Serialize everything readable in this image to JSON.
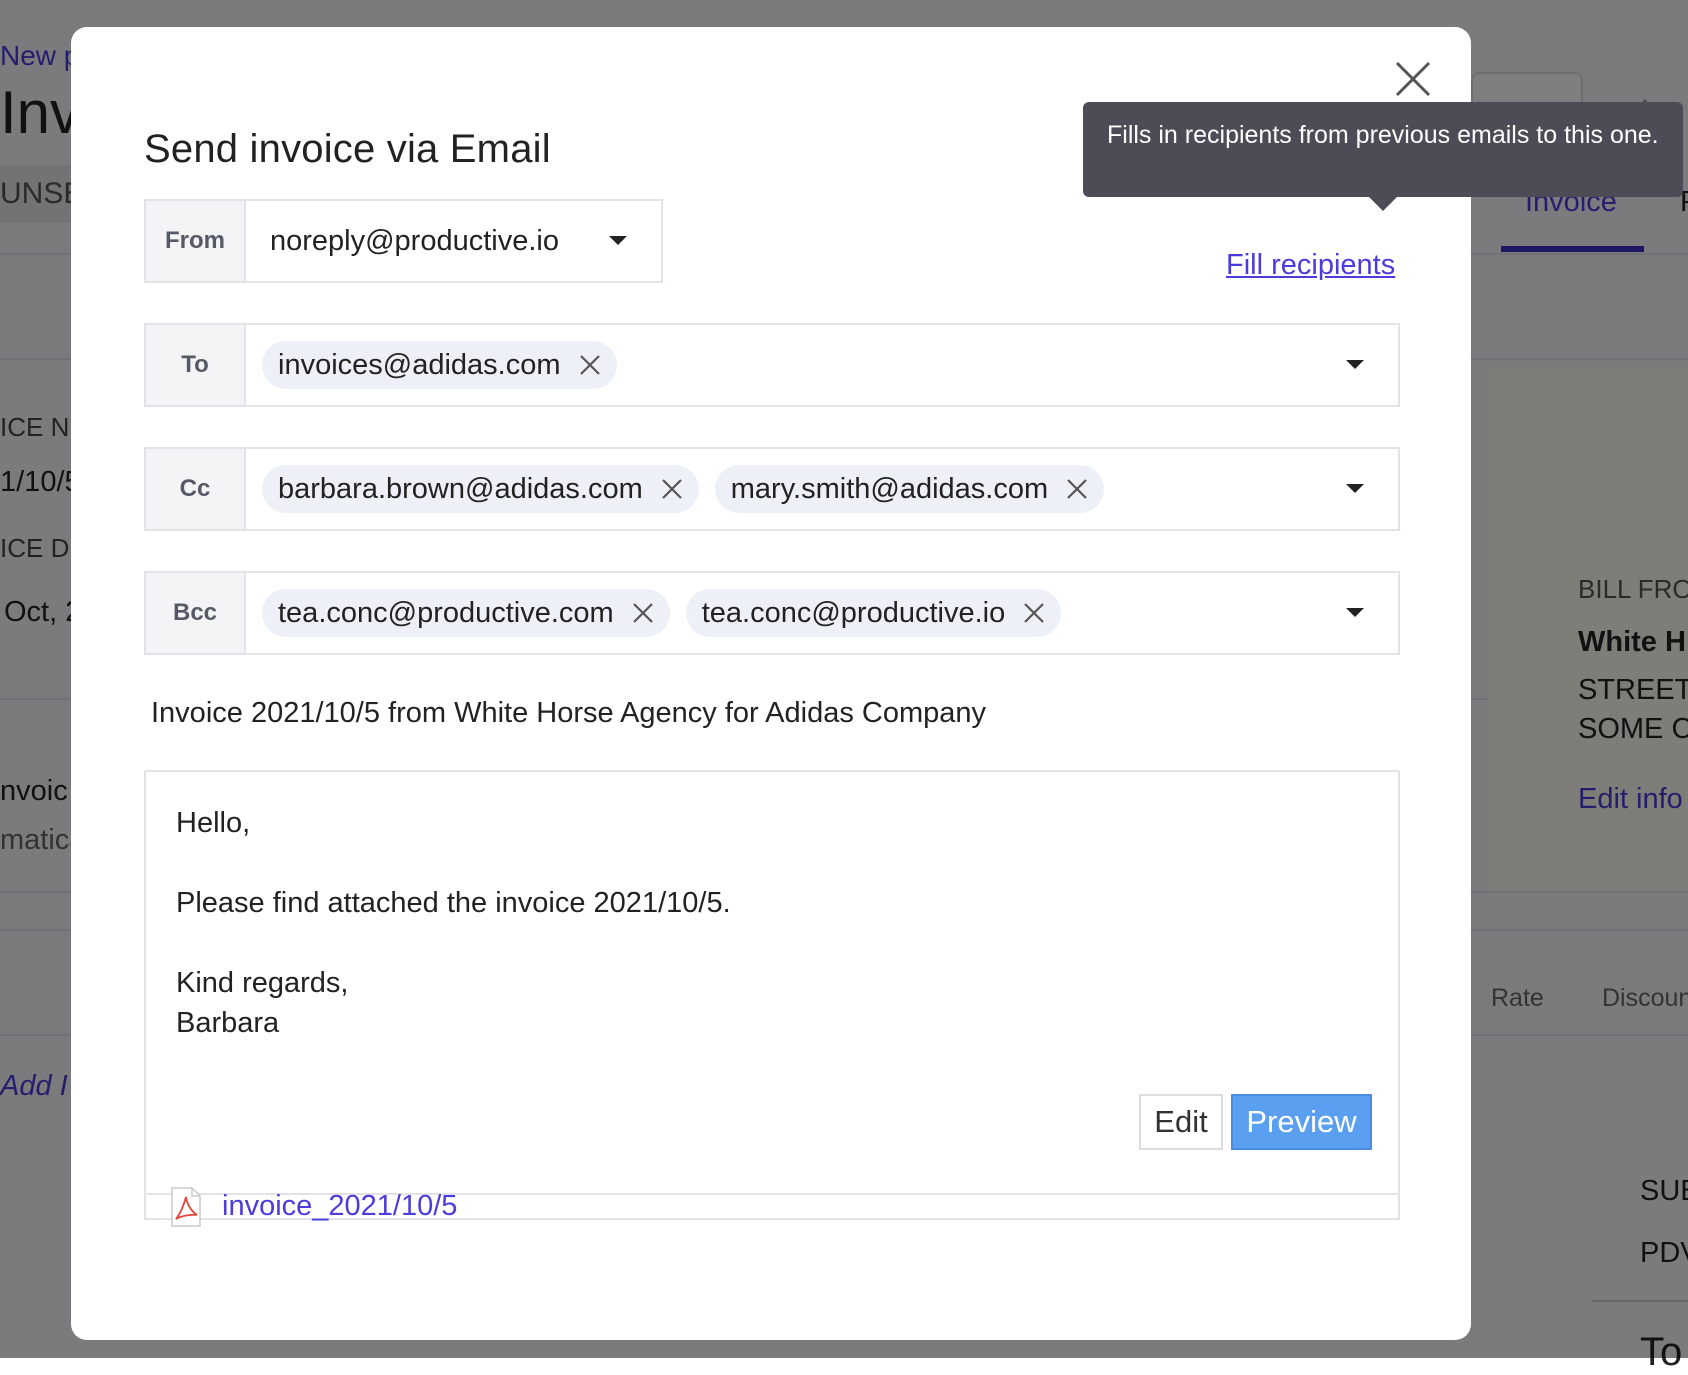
{
  "background": {
    "header_link": "New pr",
    "page_title": "Invo",
    "status_badge": "UNSE",
    "tab_invoice": "Invoice",
    "tab_next": "P",
    "invoice_number_label": "ICE N",
    "invoice_number_value": "1/10/5",
    "invoice_date_label": "ICE D",
    "invoice_date_value": "Oct, 2",
    "note_line1": "nvoic",
    "note_line2": "matica",
    "add_item_link": "Add I",
    "bill_from_label": "BILL FRO",
    "bill_from_name": "White H",
    "bill_from_street": "STREET",
    "bill_from_city": "SOME C",
    "edit_info_link": "Edit info",
    "col_rate": "Rate",
    "col_discount": "Discoun",
    "subtotal_label": "SUB",
    "pdv_label": "PDV",
    "total_label": "To"
  },
  "modal": {
    "title": "Send invoice via Email",
    "tooltip": "Fills in recipients from previous emails to this one.",
    "fill_recipients": "Fill recipients",
    "from": {
      "label": "From",
      "value": "noreply@productive.io"
    },
    "to": {
      "label": "To",
      "recipients": [
        "invoices@adidas.com"
      ]
    },
    "cc": {
      "label": "Cc",
      "recipients": [
        "barbara.brown@adidas.com",
        "mary.smith@adidas.com"
      ]
    },
    "bcc": {
      "label": "Bcc",
      "recipients": [
        "tea.conc@productive.com",
        "tea.conc@productive.io"
      ]
    },
    "subject": "Invoice 2021/10/5 from White Horse Agency for Adidas Company",
    "body": {
      "greeting": "Hello,",
      "line1": "Please find attached the invoice 2021/10/5.",
      "closing": "Kind regards,",
      "signature": "Barbara"
    },
    "edit_button": "Edit",
    "preview_button": "Preview",
    "attachment": "invoice_2021/10/5"
  },
  "colors": {
    "accent": "#4b3cdb",
    "preview_button": "#5a9ff0",
    "tooltip_bg": "#4c4b56",
    "chip_bg": "#eef0f7"
  }
}
